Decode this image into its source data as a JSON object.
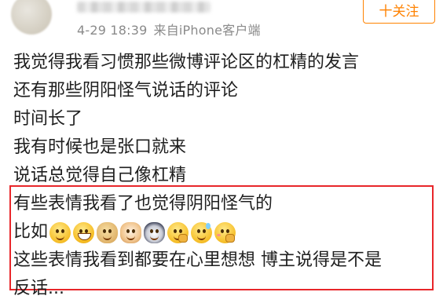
{
  "post": {
    "timestamp": "4-29 18:39",
    "source": "来自iPhone客户端",
    "follow_label": "十关注",
    "lines": [
      "我觉得我看习惯那些微博评论区的杠精的发言",
      "还有那些阴阳怪气说话的评论",
      "时间长了",
      "我有时候也是张口就来",
      "说话总觉得自己像杠精",
      "有些表情我看了也觉得阴阳怪气的",
      "比如",
      "这些表情我看到都要在心里想想 博主说得是不是",
      "反话..."
    ],
    "emojis": [
      "smile-emoji",
      "grin-emoji",
      "doge-emoji",
      "cat-emoji",
      "husky-emoji",
      "think-emoji",
      "sweat-emoji",
      "shy-emoji"
    ]
  },
  "colors": {
    "accent": "#ff8200",
    "highlight_border": "#e8262a",
    "meta_text": "#8a8a8a"
  }
}
